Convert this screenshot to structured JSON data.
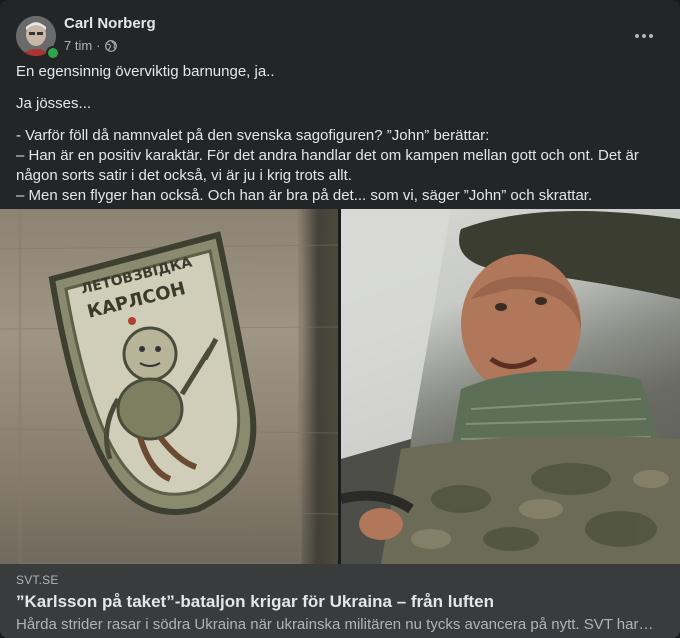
{
  "post": {
    "author": "Carl Norberg",
    "time": "7 tim",
    "separator": "·",
    "privacy_icon": "globe-icon",
    "more_icon": "more-horizontal-icon",
    "paragraphs": [
      "En egensinnig överviktig barnunge, ja..",
      "Ja jösses...",
      "- Varför föll då namnvalet på den svenska sagofiguren? ”John” berättar:\n– Han är en positiv karaktär. För det andra handlar det om kampen mellan gott och ont. Det är någon sorts satir i det också, vi är ju i krig trots allt.\n– Men sen flyger han också. Och han är bra på det... som vi, säger ”John” och skrattar."
    ]
  },
  "patch": {
    "text_top": "ЛЕТОВЗВІДКА",
    "text_name": "КАРЛСОН"
  },
  "link": {
    "domain": "SVT.SE",
    "title": "”Karlsson på taket”-bataljon krigar för Ukraina – från luften",
    "description": "Hårda strider rasar i södra Ukraina när ukrainska militären nu tycks avancera på nytt. SVT har…"
  },
  "colors": {
    "card_bg": "#242526",
    "link_bg": "#3a3b3c",
    "online": "#31a24c",
    "text_primary": "#e4e6eb",
    "text_secondary": "#b0b3b8"
  }
}
